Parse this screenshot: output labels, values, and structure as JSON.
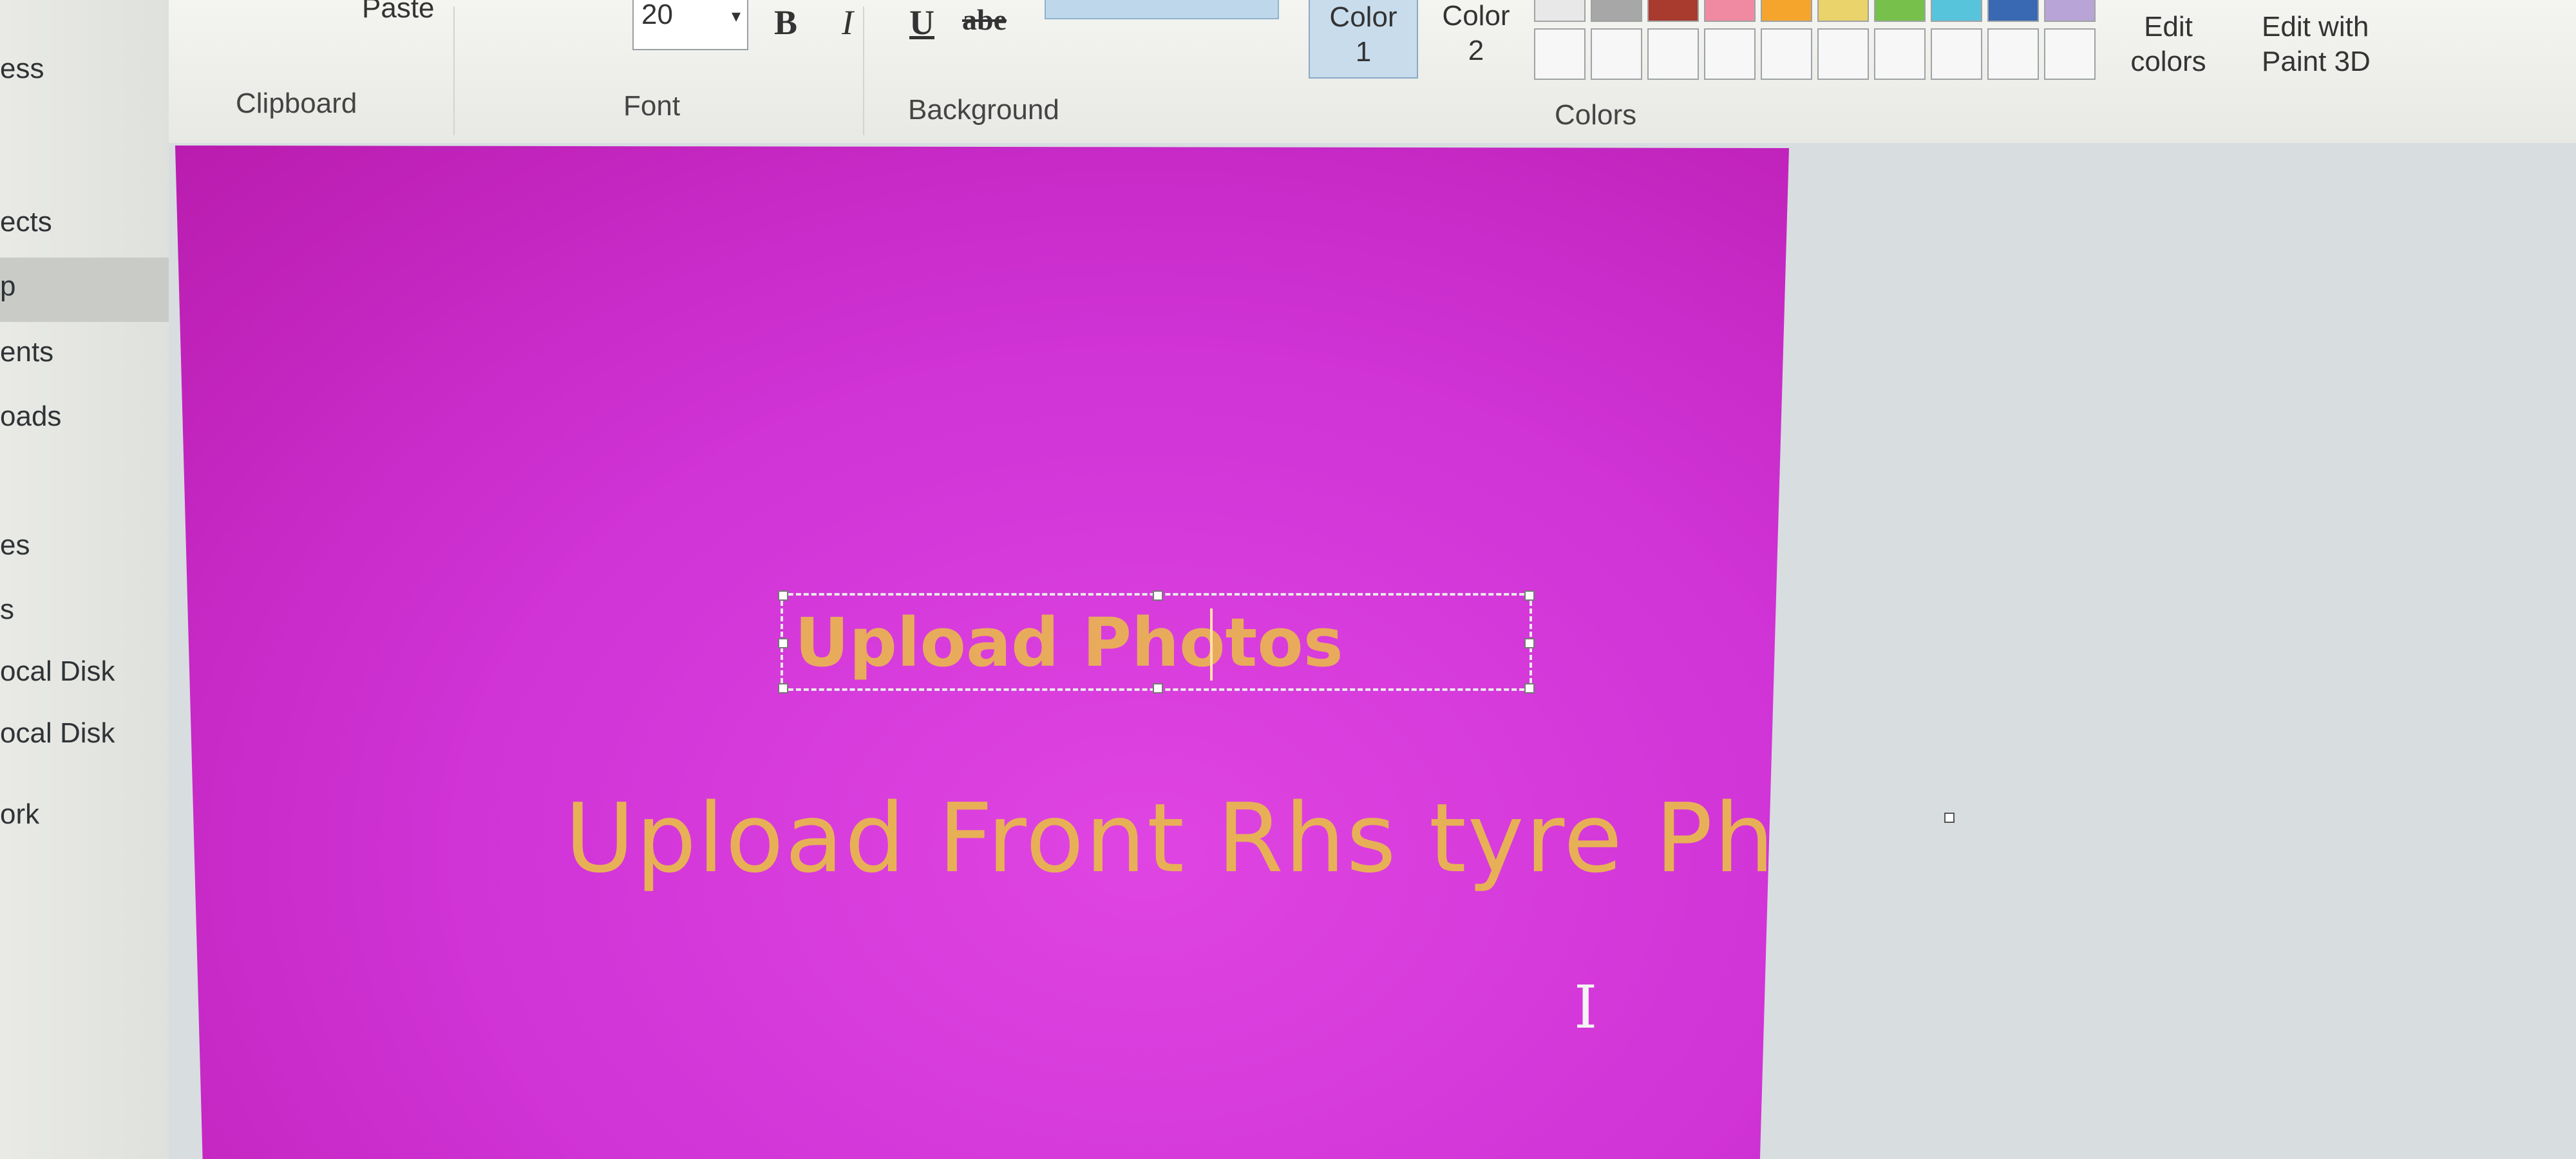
{
  "sidebar": {
    "items": [
      {
        "label": "ess"
      },
      {
        "label": "ects"
      },
      {
        "label": "p"
      },
      {
        "label": "ents"
      },
      {
        "label": "oads"
      },
      {
        "label": "es"
      },
      {
        "label": "s"
      },
      {
        "label": "ocal Disk"
      },
      {
        "label": "ocal Disk"
      },
      {
        "label": "ork"
      }
    ]
  },
  "ribbon": {
    "clipboard": {
      "paste_label": "Paste",
      "group_label": "Clipboard"
    },
    "font": {
      "size_value": "20",
      "bold": "B",
      "italic": "I",
      "underline": "U",
      "strike": "abe",
      "group_label": "Font"
    },
    "background": {
      "group_label": "Background"
    },
    "colors": {
      "color1_line1": "Color",
      "color1_line2": "1",
      "color2_line1": "Color",
      "color2_line2": "2",
      "group_label": "Colors",
      "swatches": [
        "#e8e8e8",
        "#a7a7a7",
        "#a83a2e",
        "#f08aa3",
        "#f5a52b",
        "#e9d36a",
        "#76c04b",
        "#58c4dc",
        "#3a69b3",
        "#b8a4d6"
      ],
      "edit_colors_line1": "Edit",
      "edit_colors_line2": "colors",
      "edit_paint3d_line1": "Edit with",
      "edit_paint3d_line2": "Paint 3D"
    }
  },
  "canvas": {
    "background_color": "#d63cda",
    "text_box_text": "Upload Photos",
    "text_color": "#e8ab5c",
    "canvas_text": "Upload Front Rhs tyre Photo"
  }
}
